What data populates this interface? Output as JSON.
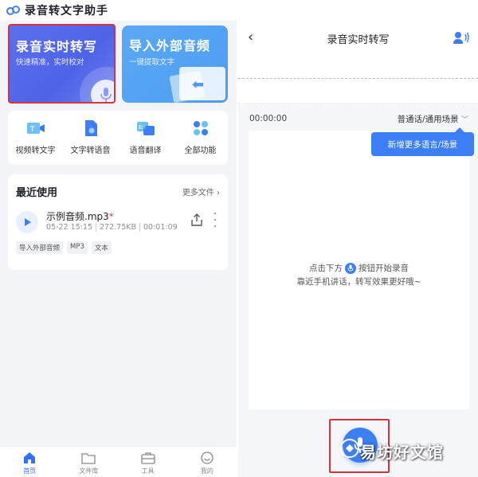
{
  "left": {
    "app_title": "录音转文字助手",
    "card_realtime": {
      "title": "录音实时转写",
      "subtitle": "快速精准，实时校对"
    },
    "card_import": {
      "title": "导入外部音频",
      "subtitle": "一键提取文字"
    },
    "tools": [
      {
        "label": "视频转文字",
        "icon": "video-to-text-icon"
      },
      {
        "label": "文字转语音",
        "icon": "text-to-speech-icon"
      },
      {
        "label": "语音翻译",
        "icon": "voice-translate-icon"
      },
      {
        "label": "全部功能",
        "icon": "all-features-icon"
      }
    ],
    "recent": {
      "title": "最近使用",
      "more": "更多文件",
      "file": {
        "name": "示例音频.mp3",
        "star": "*",
        "date": "05-22 15:15",
        "size": "272.75KB",
        "duration": "00:01:09",
        "tags": [
          "导入外部音频",
          "MP3",
          "文本"
        ]
      }
    },
    "nav": [
      {
        "label": "首页",
        "icon": "home-icon",
        "active": true
      },
      {
        "label": "文件库",
        "icon": "folder-icon",
        "active": false
      },
      {
        "label": "工具",
        "icon": "toolbox-icon",
        "active": false
      },
      {
        "label": "我的",
        "icon": "profile-icon",
        "active": false
      }
    ]
  },
  "right": {
    "title": "录音实时转写",
    "time": "00:00:00",
    "language": "普通话/通用场景",
    "tooltip": "新增更多语言/场景",
    "hint_prefix": "点击下方",
    "hint_suffix": "按钮开始录音",
    "hint_line2": "靠近手机讲话，转写效果更好哦~"
  },
  "watermark": "易坊好文馆",
  "colors": {
    "accent": "#3b7ef5",
    "highlight_border": "#d9333a",
    "card_realtime": "#5b6ff0",
    "card_import": "#5aa9f5"
  }
}
